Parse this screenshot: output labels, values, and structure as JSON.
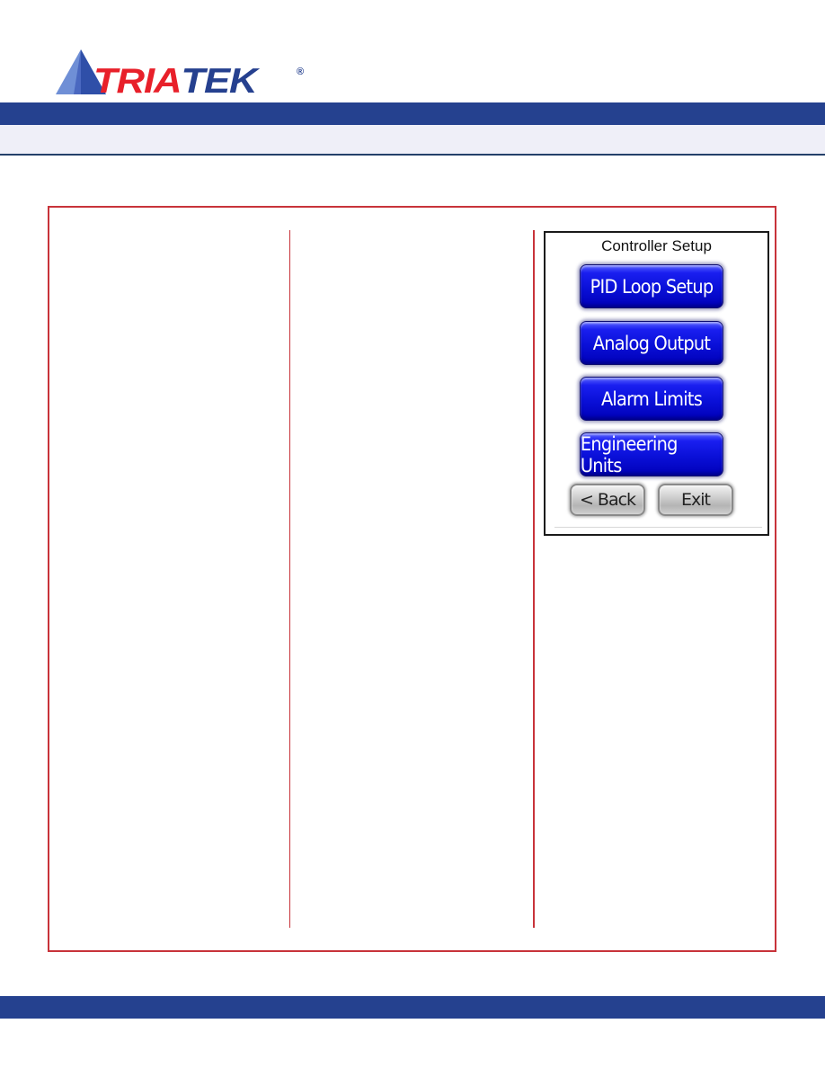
{
  "brand": {
    "logo_prefix": "TRIA",
    "logo_suffix": "TEK",
    "registered_mark": "®",
    "colors": {
      "red": "#e8202a",
      "blue": "#25408f",
      "triangle_light": "#6f8fd6",
      "triangle_dark": "#2f4fa8"
    }
  },
  "header": {
    "bar_color": "#25418f",
    "band_color": "#efeff8"
  },
  "frame": {
    "border_color": "#c8333a"
  },
  "columns": [
    {
      "text": ""
    },
    {
      "text": ""
    },
    {
      "text": ""
    }
  ],
  "device_screen": {
    "title": "Controller Setup",
    "menu_buttons": [
      {
        "label": "PID Loop Setup"
      },
      {
        "label": "Analog Output"
      },
      {
        "label": "Alarm Limits"
      },
      {
        "label": "Engineering Units"
      }
    ],
    "nav_buttons": {
      "back": "< Back",
      "exit": "Exit"
    },
    "button_color": "#0a10d8"
  },
  "footer": {
    "bar_color": "#25418f"
  }
}
